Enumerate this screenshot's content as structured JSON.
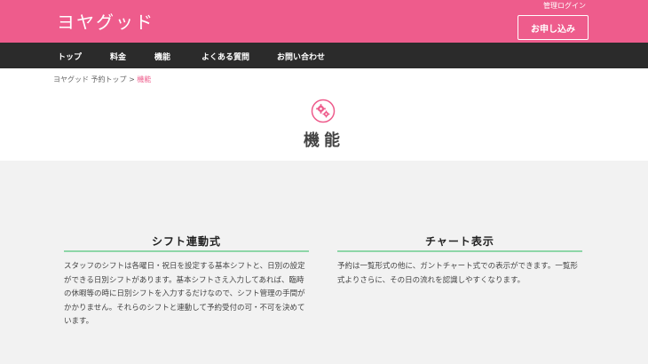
{
  "header": {
    "logo": "ヨヤグッド",
    "admin_login": "管理ログイン",
    "apply_button": "お申し込み"
  },
  "nav": {
    "items": [
      {
        "label": "トップ"
      },
      {
        "label": "料金"
      },
      {
        "label": "機能"
      },
      {
        "label": "よくある質問"
      },
      {
        "label": "お問い合わせ"
      }
    ]
  },
  "breadcrumb": {
    "parent": "ヨヤグッド 予約トップ",
    "separator": ">",
    "current": "機能"
  },
  "page": {
    "title": "機能",
    "icon": "gears-icon"
  },
  "features": [
    {
      "title": "シフト連動式",
      "text": "スタッフのシフトは各曜日・祝日を設定する基本シフトと、日別の設定ができる日別シフトがあります。基本シフトさえ入力してあれば、臨時の休暇等の時に日別シフトを入力するだけなので、シフト管理の手間がかかりません。それらのシフトと連動して予約受付の可・不可を決めています。"
    },
    {
      "title": "チャート表示",
      "text": "予約は一覧形式の他に、ガントチャート式での表示ができます。一覧形式よりさらに、その日の流れを認識しやすくなります。"
    }
  ],
  "colors": {
    "brand_pink": "#ee5c8c",
    "nav_dark": "#2b2b2b",
    "accent_green": "#8ed6a8"
  }
}
